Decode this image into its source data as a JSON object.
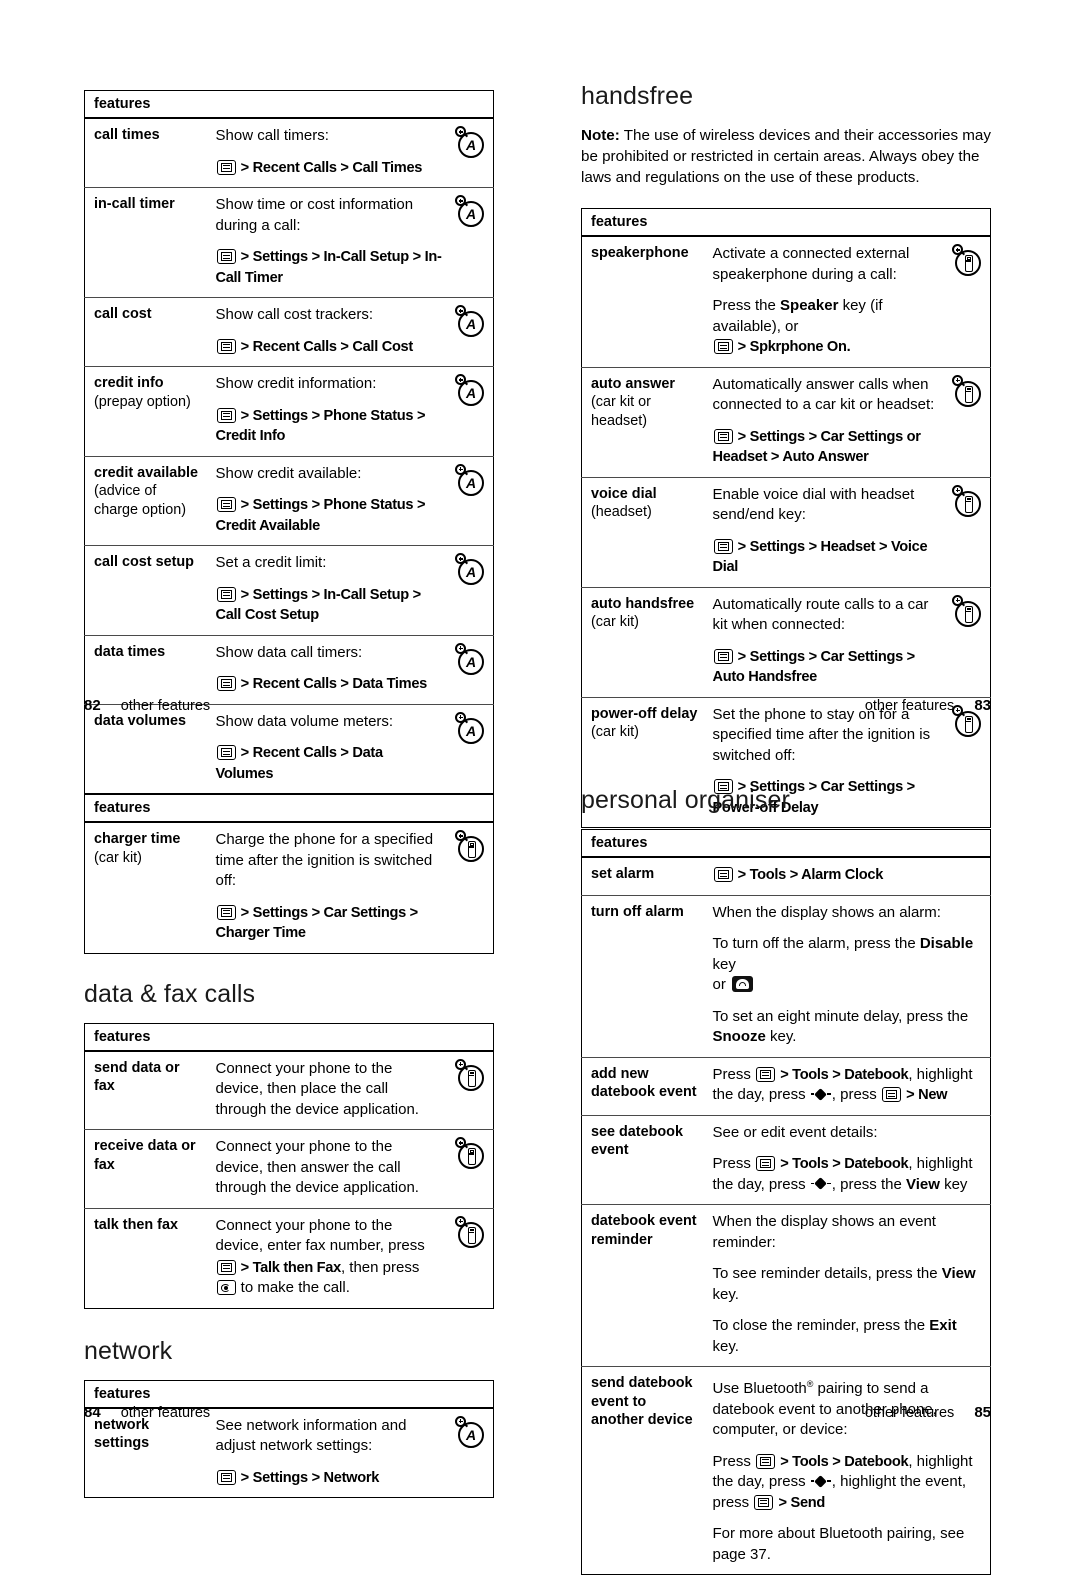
{
  "pages": [
    {
      "id": "p82-83",
      "left": {
        "sections": [
          {
            "heading": null,
            "table": {
              "header": "features",
              "rows": [
                {
                  "name": "call times",
                  "sub": null,
                  "desc": [
                    {
                      "type": "text",
                      "text": "Show call timers:"
                    },
                    {
                      "type": "path",
                      "prefix_icon": "menu-key",
                      "text": "> Recent Calls > Call Times"
                    }
                  ],
                  "icon": "network-feature-icon"
                },
                {
                  "name": "in-call timer",
                  "sub": null,
                  "desc": [
                    {
                      "type": "text",
                      "text": "Show time or cost information during a call:"
                    },
                    {
                      "type": "path",
                      "prefix_icon": "menu-key",
                      "text": "> Settings > In-Call Setup > In-Call Timer"
                    }
                  ],
                  "icon": "network-feature-icon"
                },
                {
                  "name": "call cost",
                  "sub": null,
                  "desc": [
                    {
                      "type": "text",
                      "text": "Show call cost trackers:"
                    },
                    {
                      "type": "path",
                      "prefix_icon": "menu-key",
                      "text": "> Recent Calls > Call Cost"
                    }
                  ],
                  "icon": "network-feature-icon"
                },
                {
                  "name": "credit info",
                  "sub": "(prepay option)",
                  "desc": [
                    {
                      "type": "text",
                      "text": "Show credit information:"
                    },
                    {
                      "type": "path",
                      "prefix_icon": "menu-key",
                      "text": "> Settings > Phone Status > Credit Info"
                    }
                  ],
                  "icon": "network-feature-icon"
                },
                {
                  "name": "credit available",
                  "sub": "(advice of charge option)",
                  "desc": [
                    {
                      "type": "text",
                      "text": "Show credit available:"
                    },
                    {
                      "type": "path",
                      "prefix_icon": "menu-key",
                      "text": "> Settings > Phone Status > Credit Available"
                    }
                  ],
                  "icon": "network-feature-icon"
                },
                {
                  "name": "call cost setup",
                  "sub": null,
                  "desc": [
                    {
                      "type": "text",
                      "text": "Set a credit limit:"
                    },
                    {
                      "type": "path",
                      "prefix_icon": "menu-key",
                      "text": "> Settings > In-Call Setup > Call Cost Setup"
                    }
                  ],
                  "icon": "network-feature-icon"
                },
                {
                  "name": "data times",
                  "sub": null,
                  "desc": [
                    {
                      "type": "text",
                      "text": "Show data call timers:"
                    },
                    {
                      "type": "path",
                      "prefix_icon": "menu-key",
                      "text": "> Recent Calls > Data Times"
                    }
                  ],
                  "icon": "network-feature-icon"
                },
                {
                  "name": "data volumes",
                  "sub": null,
                  "desc": [
                    {
                      "type": "text",
                      "text": "Show data volume meters:"
                    },
                    {
                      "type": "path",
                      "prefix_icon": "menu-key",
                      "text": "> Recent Calls > Data Volumes"
                    }
                  ],
                  "icon": "network-feature-icon"
                }
              ]
            }
          }
        ],
        "footer": {
          "page_number": "82",
          "label": "other features"
        }
      },
      "right": {
        "heading": "handsfree",
        "note": {
          "label": "Note:",
          "text": " The use of wireless devices and their accessories may be prohibited or restricted in certain areas. Always obey the laws and regulations on the use of these products."
        },
        "table": {
          "header": "features",
          "rows": [
            {
              "name": "speakerphone",
              "sub": null,
              "desc": [
                {
                  "type": "text",
                  "text": "Activate a connected external speakerphone during a call:"
                },
                {
                  "type": "mixed",
                  "text": "Press the Speaker key (if available), or"
                },
                {
                  "type": "path",
                  "prefix_icon": "menu-key",
                  "text": "> Spkrphone On."
                }
              ],
              "icon": "handset-feature-icon"
            },
            {
              "name": "auto answer",
              "sub": "(car kit or headset)",
              "desc": [
                {
                  "type": "text",
                  "text": "Automatically answer calls when connected to a car kit or headset:"
                },
                {
                  "type": "path",
                  "prefix_icon": "menu-key",
                  "text": "> Settings > Car Settings or Headset > Auto Answer"
                }
              ],
              "icon": "handset-feature-icon"
            },
            {
              "name": "voice dial",
              "sub": "(headset)",
              "desc": [
                {
                  "type": "text",
                  "text": "Enable voice dial with headset send/end key:"
                },
                {
                  "type": "path",
                  "prefix_icon": "menu-key",
                  "text": "> Settings > Headset > Voice Dial"
                }
              ],
              "icon": "handset-feature-icon"
            },
            {
              "name": "auto handsfree",
              "sub": "(car kit)",
              "desc": [
                {
                  "type": "text",
                  "text": "Automatically route calls to a car kit when connected:"
                },
                {
                  "type": "path",
                  "prefix_icon": "menu-key",
                  "text": "> Settings > Car Settings > Auto Handsfree"
                }
              ],
              "icon": "handset-feature-icon"
            },
            {
              "name": "power-off delay",
              "sub": "(car kit)",
              "desc": [
                {
                  "type": "text",
                  "text": "Set the phone to stay on for a specified time after the ignition is switched off:"
                },
                {
                  "type": "path",
                  "prefix_icon": "menu-key",
                  "text": "> Settings > Car Settings > Power-off Delay"
                }
              ],
              "icon": "handset-feature-icon"
            }
          ]
        },
        "footer": {
          "page_number": "83",
          "label": "other features"
        }
      }
    },
    {
      "id": "p84-85",
      "left": {
        "table_charger": {
          "header": "features",
          "rows": [
            {
              "name": "charger time",
              "sub": "(car kit)",
              "desc": [
                {
                  "type": "text",
                  "text": "Charge the phone for a specified time after the ignition is switched off:"
                },
                {
                  "type": "path",
                  "prefix_icon": "menu-key",
                  "text": "> Settings > Car Settings > Charger Time"
                }
              ],
              "icon": "handset-feature-icon"
            }
          ]
        },
        "heading_data_fax": "data & fax calls",
        "table_datafax": {
          "header": "features",
          "rows": [
            {
              "name": "send data or fax",
              "sub": null,
              "desc": [
                {
                  "type": "text",
                  "text": "Connect your phone to the device, then place the call through the device application."
                }
              ],
              "icon": "handset-feature-icon"
            },
            {
              "name": "receive data or fax",
              "sub": null,
              "desc": [
                {
                  "type": "text",
                  "text": "Connect your phone to the device, then answer the call through the device application."
                }
              ],
              "icon": "handset-feature-icon"
            },
            {
              "name": "talk then fax",
              "sub": null,
              "desc": [
                {
                  "type": "text",
                  "text": "Connect your phone to the device, enter fax number, press"
                },
                {
                  "type": "talkfax",
                  "text": "> Talk then Fax, then press  to make the call."
                }
              ],
              "icon": "handset-feature-icon"
            }
          ]
        },
        "heading_network": "network",
        "table_network": {
          "header": "features",
          "rows": [
            {
              "name": "network settings",
              "sub": null,
              "desc": [
                {
                  "type": "text",
                  "text": "See network information and adjust network settings:"
                },
                {
                  "type": "path",
                  "prefix_icon": "menu-key",
                  "text": "> Settings > Network"
                }
              ],
              "icon": "network-feature-icon"
            }
          ]
        },
        "footer": {
          "page_number": "84",
          "label": "other features"
        }
      },
      "right": {
        "heading": "personal organiser",
        "table": {
          "header": "features",
          "rows": [
            {
              "name": "set alarm",
              "sub": null,
              "desc": [
                {
                  "type": "path-only",
                  "prefix_icon": "menu-key",
                  "text": "> Tools > Alarm Clock"
                }
              ],
              "icon": null
            },
            {
              "name": "turn off alarm",
              "sub": null,
              "desc": [
                {
                  "type": "text",
                  "text": "When the display shows an alarm:"
                },
                {
                  "type": "alarm-off",
                  "text": "To turn off the alarm, press the Disable key or"
                },
                {
                  "type": "snooze",
                  "text": "To set an eight minute delay, press the Snooze key."
                }
              ],
              "icon": null
            },
            {
              "name": "add new datebook event",
              "sub": null,
              "desc": [
                {
                  "type": "datebook-new",
                  "text": "Press  > Tools > Datebook, highlight the day, press , press  > New"
                }
              ],
              "icon": null
            },
            {
              "name": "see datebook event",
              "sub": null,
              "desc": [
                {
                  "type": "text",
                  "text": "See or edit event details:"
                },
                {
                  "type": "datebook-view",
                  "text": "Press  > Tools > Datebook, highlight the day, press , press the View key"
                }
              ],
              "icon": null
            },
            {
              "name": "datebook event reminder",
              "sub": null,
              "desc": [
                {
                  "type": "text",
                  "text": "When the display shows an event reminder:"
                },
                {
                  "type": "view-key",
                  "text": "To see reminder details, press the View key."
                },
                {
                  "type": "exit-key",
                  "text": "To close the reminder, press the Exit key."
                }
              ],
              "icon": null
            },
            {
              "name": "send datebook event to another device",
              "sub": null,
              "desc": [
                {
                  "type": "bluetooth",
                  "text": "Use Bluetooth pairing to send a datebook event to another phone, computer, or device:"
                },
                {
                  "type": "datebook-send",
                  "text": "Press  > Tools > Datebook, highlight the day, press , highlight the event, press  > Send"
                },
                {
                  "type": "text",
                  "text": "For more about Bluetooth pairing, see page 37."
                }
              ],
              "icon": null
            }
          ]
        },
        "footer": {
          "page_number": "85",
          "label": "other features"
        }
      }
    }
  ],
  "labels": {
    "features_header": "features",
    "note_prefix": "Note:",
    "speaker_key": "Speaker",
    "disable_key": "Disable",
    "snooze_key": "Snooze",
    "view_key": "View",
    "exit_key": "Exit",
    "new_item": "New",
    "send_item": "Send",
    "bluetooth": "Bluetooth",
    "registered_mark": "®",
    "page_ref": "page 37."
  },
  "colors": {
    "text": "#000000",
    "background": "#ffffff",
    "rule": "#4a4a4a",
    "heading": "#1a1a1a"
  }
}
